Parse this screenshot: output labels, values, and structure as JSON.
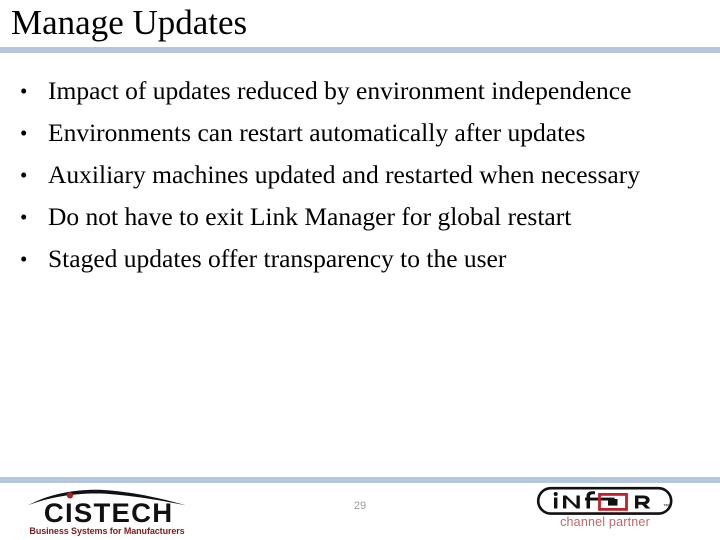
{
  "slide": {
    "title": "Manage Updates",
    "bullets": [
      {
        "marker": "•",
        "text": "Impact of updates reduced by environment independence"
      },
      {
        "marker": "•",
        "text": "Environments can restart automatically after updates"
      },
      {
        "marker": "•",
        "text": "Auxiliary machines updated and restarted when necessary"
      },
      {
        "marker": "•",
        "text": "Do not have to exit Link Manager for global restart"
      },
      {
        "marker": "•",
        "text": "Staged updates offer transparency to the user"
      }
    ]
  },
  "footer": {
    "page_number": "29",
    "cistech_logo": {
      "wordmark": "CISTECH",
      "tagline": "Business Systems for Manufacturers",
      "swoosh_color": "#111111",
      "dot_color": "#b02020",
      "tagline_color": "#7b1c1c"
    },
    "infor_logo": {
      "letters": [
        {
          "glyph": "i"
        },
        {
          "glyph": "N"
        },
        {
          "glyph": "f"
        },
        {
          "glyph": "O"
        },
        {
          "glyph": "R"
        }
      ],
      "wordmark": "iNfOR",
      "trademark": "™",
      "tagline": "channel partner",
      "box_color": "#c02026",
      "tagline_color": "#c1666b",
      "outline_color": "#111111"
    }
  },
  "theme": {
    "rule_color": "#b4c7dc",
    "background": "#ffffff",
    "text_color": "#000000",
    "page_number_color": "#9a9a9a"
  }
}
